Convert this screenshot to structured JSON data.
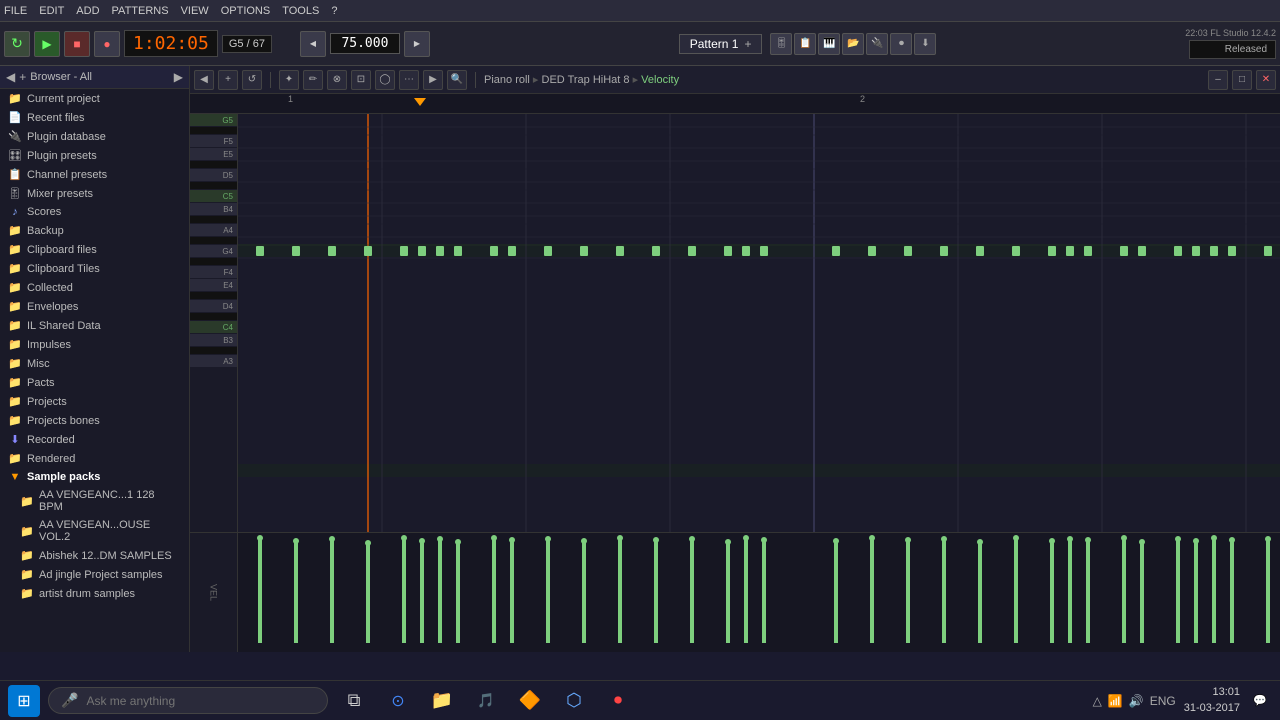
{
  "menu": {
    "items": [
      "FILE",
      "EDIT",
      "ADD",
      "PATTERNS",
      "VIEW",
      "OPTIONS",
      "TOOLS",
      "?"
    ]
  },
  "transport": {
    "time": "1:02:05",
    "note_pos": "G5 / 67",
    "tempo": "75.000",
    "pattern": "Pattern 1",
    "version": "22:03  FL Studio 12.4.2",
    "status": "Released",
    "buttons": [
      "⏮",
      "▶",
      "■",
      "●"
    ]
  },
  "piano_roll": {
    "breadcrumb": [
      "Piano roll",
      "DED Trap HiHat 8",
      "Velocity"
    ],
    "window_title": "Piano Roll"
  },
  "sidebar": {
    "browser_label": "Browser - All",
    "items": [
      {
        "label": "Current project",
        "icon": "📁",
        "type": "folder"
      },
      {
        "label": "Recent files",
        "icon": "📄",
        "type": "file"
      },
      {
        "label": "Plugin database",
        "icon": "🔌",
        "type": "folder"
      },
      {
        "label": "Plugin presets",
        "icon": "🎛",
        "type": "folder"
      },
      {
        "label": "Channel presets",
        "icon": "📋",
        "type": "folder"
      },
      {
        "label": "Mixer presets",
        "icon": "🎚",
        "type": "folder"
      },
      {
        "label": "Scores",
        "icon": "🎵",
        "type": "music"
      },
      {
        "label": "Backup",
        "icon": "💾",
        "type": "folder"
      },
      {
        "label": "Clipboard files",
        "icon": "📋",
        "type": "folder"
      },
      {
        "label": "Clipboard Tiles",
        "icon": "📋",
        "type": "folder"
      },
      {
        "label": "Collected",
        "icon": "📁",
        "type": "folder"
      },
      {
        "label": "Envelopes",
        "icon": "📁",
        "type": "folder"
      },
      {
        "label": "IL Shared Data",
        "icon": "📁",
        "type": "folder"
      },
      {
        "label": "Impulses",
        "icon": "📁",
        "type": "folder"
      },
      {
        "label": "Misc",
        "icon": "📁",
        "type": "folder"
      },
      {
        "label": "Pacts",
        "icon": "📁",
        "type": "folder"
      },
      {
        "label": "Projects",
        "icon": "📁",
        "type": "folder"
      },
      {
        "label": "Projects bones",
        "icon": "📁",
        "type": "folder"
      },
      {
        "label": "Recorded",
        "icon": "⬇",
        "type": "special"
      },
      {
        "label": "Rendered",
        "icon": "📁",
        "type": "folder"
      },
      {
        "label": "Sample packs",
        "icon": "📁",
        "type": "folder",
        "expanded": true
      },
      {
        "label": "AA VENGEANC...1 128 BPM",
        "icon": "📁",
        "type": "sub"
      },
      {
        "label": "AA VENGEAN...OUSE VOL.2",
        "icon": "📁",
        "type": "sub"
      },
      {
        "label": "Abishek 12..DM SAMPLES",
        "icon": "📁",
        "type": "sub"
      },
      {
        "label": "Ad jingle Project samples",
        "icon": "📁",
        "type": "sub"
      },
      {
        "label": "artist drum samples",
        "icon": "📁",
        "type": "sub"
      }
    ]
  },
  "piano_notes": {
    "keys": [
      {
        "note": "G5",
        "type": "white"
      },
      {
        "note": "F#5",
        "type": "black"
      },
      {
        "note": "F5",
        "type": "white"
      },
      {
        "note": "E5",
        "type": "white"
      },
      {
        "note": "D#5",
        "type": "black"
      },
      {
        "note": "D5",
        "type": "white"
      },
      {
        "note": "C#5",
        "type": "black"
      },
      {
        "note": "C5",
        "type": "white",
        "c": true
      },
      {
        "note": "B4",
        "type": "white"
      },
      {
        "note": "A#4",
        "type": "black"
      },
      {
        "note": "A4",
        "type": "white"
      },
      {
        "note": "G#4",
        "type": "black"
      },
      {
        "note": "G4",
        "type": "white"
      },
      {
        "note": "F#4",
        "type": "black"
      },
      {
        "note": "F4",
        "type": "white"
      },
      {
        "note": "E4",
        "type": "white"
      },
      {
        "note": "D#4",
        "type": "black"
      },
      {
        "note": "D4",
        "type": "white"
      },
      {
        "note": "C#4",
        "type": "black"
      },
      {
        "note": "C4",
        "type": "white",
        "c": true
      },
      {
        "note": "B3",
        "type": "white"
      },
      {
        "note": "A#3",
        "type": "black"
      },
      {
        "note": "A3",
        "type": "white"
      }
    ]
  },
  "taskbar": {
    "search_placeholder": "Ask me anything",
    "time": "13:01",
    "date": "31-03-2017",
    "lang": "ENG"
  },
  "colors": {
    "note_color": "#7ecf7e",
    "note_active": "#a0e8a0",
    "bg_dark": "#161622",
    "bg_mid": "#1e1e2e",
    "bg_light": "#2a2a3a",
    "timeline_arrow": "#ff9900",
    "accent": "#ff6600"
  }
}
